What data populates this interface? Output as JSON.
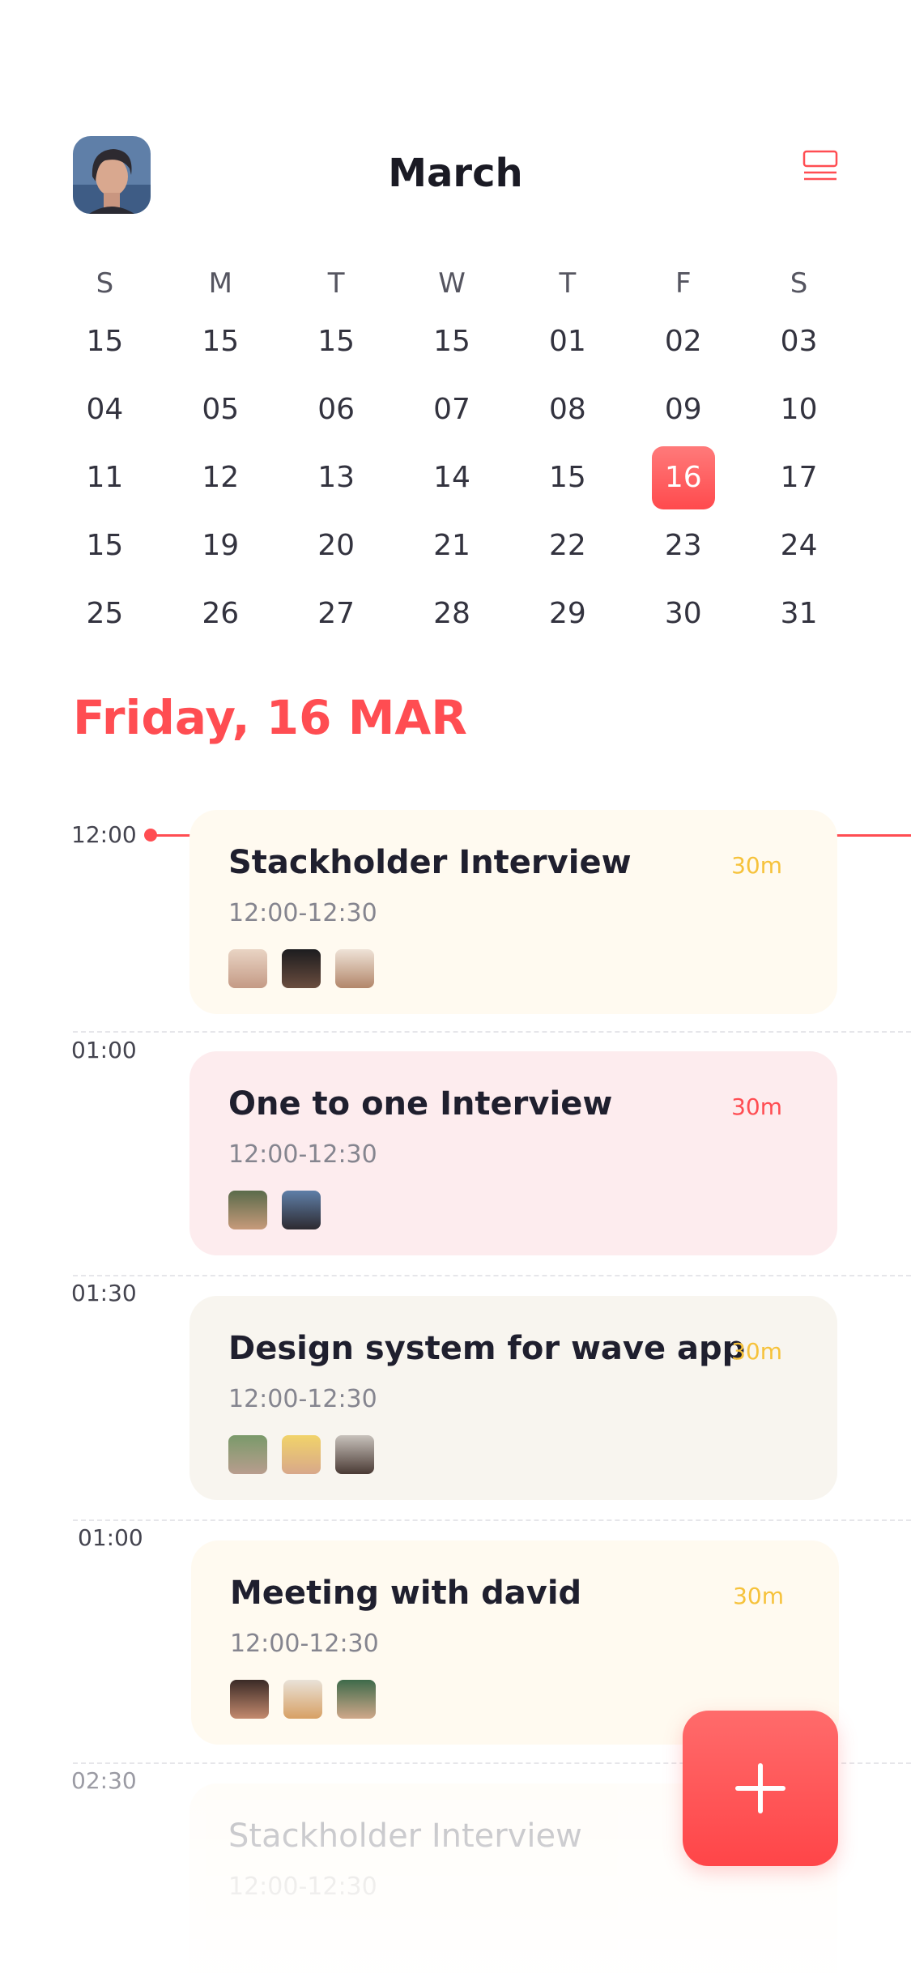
{
  "header": {
    "title": "March",
    "avatar_label": "profile-avatar",
    "menu_icon": "list-view-icon"
  },
  "calendar": {
    "weekdays": [
      "S",
      "M",
      "T",
      "W",
      "T",
      "F",
      "S"
    ],
    "weeks": [
      [
        "15",
        "15",
        "15",
        "15",
        "01",
        "02",
        "03"
      ],
      [
        "04",
        "05",
        "06",
        "07",
        "08",
        "09",
        "10"
      ],
      [
        "11",
        "12",
        "13",
        "14",
        "15",
        "16",
        "17"
      ],
      [
        "15",
        "19",
        "20",
        "21",
        "22",
        "23",
        "24"
      ],
      [
        "25",
        "26",
        "27",
        "28",
        "29",
        "30",
        "31"
      ]
    ],
    "selected": "16"
  },
  "day_title": "Friday, 16 MAR",
  "times": [
    "12:00",
    "01:00",
    "01:30",
    "01:00",
    "02:30"
  ],
  "events": [
    {
      "title": "Stackholder Interview",
      "time": "12:00-12:30",
      "duration": "30m"
    },
    {
      "title": "One to one Interview",
      "time": "12:00-12:30",
      "duration": "30m"
    },
    {
      "title": "Design system for wave app",
      "time": "12:00-12:30",
      "duration": "30m"
    },
    {
      "title": "Meeting with david",
      "time": "12:00-12:30",
      "duration": "30m"
    },
    {
      "title": "Stackholder Interview",
      "time": "12:00-12:30",
      "duration": ""
    }
  ],
  "colors": {
    "accent": "#ff4d52",
    "duration_yellow": "#f6c23b"
  },
  "fab_icon": "plus-icon"
}
